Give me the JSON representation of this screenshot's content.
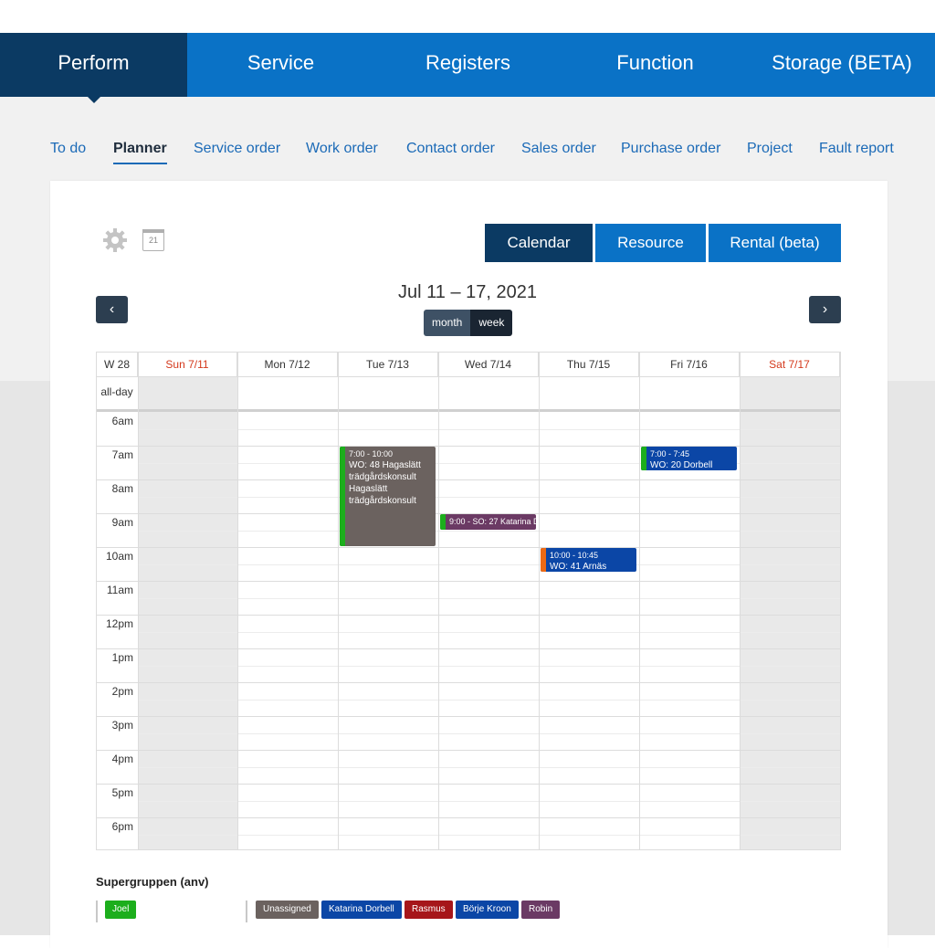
{
  "topnav": [
    {
      "label": "Perform",
      "active": true
    },
    {
      "label": "Service",
      "active": false
    },
    {
      "label": "Registers",
      "active": false
    },
    {
      "label": "Function",
      "active": false
    },
    {
      "label": "Storage (BETA)",
      "active": false
    }
  ],
  "subnav": [
    {
      "label": "To do"
    },
    {
      "label": "Planner",
      "active": true
    },
    {
      "label": "Service order"
    },
    {
      "label": "Work order"
    },
    {
      "label": "Contact order"
    },
    {
      "label": "Sales order"
    },
    {
      "label": "Purchase order"
    },
    {
      "label": "Project"
    },
    {
      "label": "Fault report"
    }
  ],
  "toolbar": {
    "calendar_day": "21"
  },
  "views": [
    {
      "label": "Calendar",
      "active": true
    },
    {
      "label": "Resource"
    },
    {
      "label": "Rental (beta)"
    }
  ],
  "calendar": {
    "title": "Jul 11 – 17, 2021",
    "prev": "‹",
    "next": "›",
    "mode_month": "month",
    "mode_week": "week",
    "week_label": "W 28",
    "allday_label": "all-day",
    "days": [
      {
        "label": "Sun 7/11",
        "weekend": true
      },
      {
        "label": "Mon 7/12",
        "weekend": false
      },
      {
        "label": "Tue 7/13",
        "weekend": false
      },
      {
        "label": "Wed 7/14",
        "weekend": false
      },
      {
        "label": "Thu 7/15",
        "weekend": false
      },
      {
        "label": "Fri 7/16",
        "weekend": false
      },
      {
        "label": "Sat 7/17",
        "weekend": true
      }
    ],
    "hours": [
      "6am",
      "7am",
      "8am",
      "9am",
      "10am",
      "11am",
      "12pm",
      "1pm",
      "2pm",
      "3pm",
      "4pm",
      "5pm",
      "6pm"
    ],
    "events": [
      {
        "day": 2,
        "start": 7.0,
        "end": 10.0,
        "time": "7:00 - 10:00",
        "title": "WO: 48 Hagaslätt trädgårdskonsult Hagaslätt trädgårdskonsult",
        "color": "#6b625f",
        "bar": "#1cae1c"
      },
      {
        "day": 3,
        "start": 9.0,
        "end": 9.5,
        "time": "9:00 - SO: 27 Katarina D",
        "title": "",
        "color": "#6b3a64",
        "bar": "#1cae1c"
      },
      {
        "day": 4,
        "start": 10.0,
        "end": 10.75,
        "time": "10:00 - 10:45",
        "title": "WO: 41 Arnäs",
        "color": "#0b46a6",
        "bar": "#ec6a15"
      },
      {
        "day": 5,
        "start": 7.0,
        "end": 7.75,
        "time": "7:00 - 7:45",
        "title": "WO: 20 Dorbell",
        "color": "#0b46a6",
        "bar": "#1cae1c"
      }
    ]
  },
  "group": {
    "title": "Supergruppen (anv)",
    "left_tags": [
      {
        "label": "Joel",
        "color": "#1cae1c"
      }
    ],
    "right_tags": [
      {
        "label": "Unassigned",
        "color": "#6b625f"
      },
      {
        "label": "Katarina Dorbell",
        "color": "#0b46a6"
      },
      {
        "label": "Rasmus",
        "color": "#a6161a"
      },
      {
        "label": "Börje Kroon",
        "color": "#0b46a6"
      },
      {
        "label": "Robin",
        "color": "#6b3a64"
      }
    ]
  }
}
